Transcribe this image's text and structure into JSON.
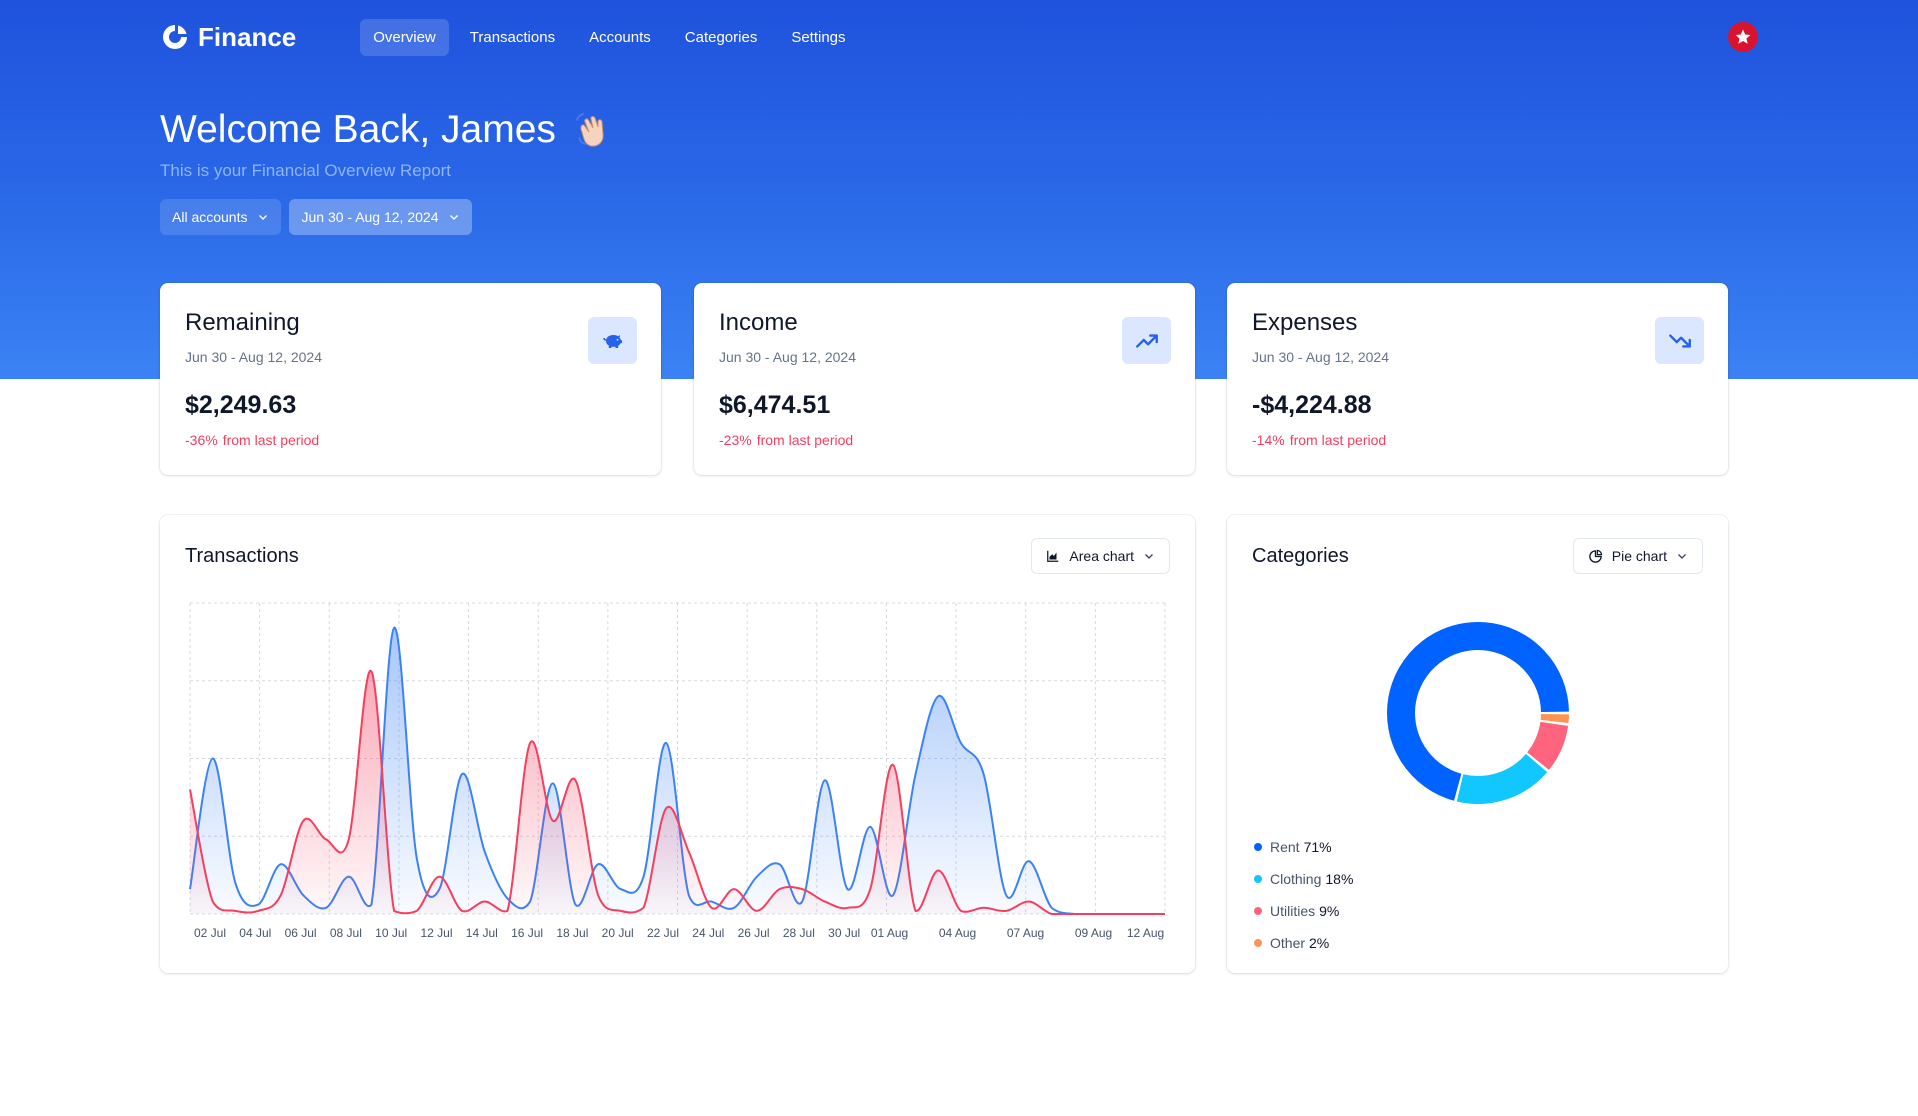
{
  "header": {
    "brand": "Finance",
    "nav": [
      {
        "label": "Overview",
        "active": true
      },
      {
        "label": "Transactions",
        "active": false
      },
      {
        "label": "Accounts",
        "active": false
      },
      {
        "label": "Categories",
        "active": false
      },
      {
        "label": "Settings",
        "active": false
      }
    ]
  },
  "welcome": {
    "title": "Welcome Back, James",
    "subtitle": "This is your Financial Overview Report"
  },
  "filters": {
    "account": "All accounts",
    "date_range": "Jun 30 - Aug 12, 2024"
  },
  "stats": [
    {
      "title": "Remaining",
      "range": "Jun 30 - Aug 12, 2024",
      "value": "$2,249.63",
      "change": "-36%",
      "change_label": "from last period",
      "icon": "piggy-bank-icon"
    },
    {
      "title": "Income",
      "range": "Jun 30 - Aug 12, 2024",
      "value": "$6,474.51",
      "change": "-23%",
      "change_label": "from last period",
      "icon": "trending-up-icon"
    },
    {
      "title": "Expenses",
      "range": "Jun 30 - Aug 12, 2024",
      "value": "-$4,224.88",
      "change": "-14%",
      "change_label": "from last period",
      "icon": "trending-down-icon"
    }
  ],
  "transactions_panel": {
    "title": "Transactions",
    "chart_type_label": "Area chart"
  },
  "categories_panel": {
    "title": "Categories",
    "chart_type_label": "Pie chart"
  },
  "colors": {
    "income": "#3b82f6",
    "expenses": "#f43f5e",
    "rent": "#0062ff",
    "clothing": "#12c6ff",
    "utilities": "#ff647f",
    "other": "#ff9354"
  },
  "chart_data": [
    {
      "type": "area",
      "title": "",
      "x_tick_labels": [
        "02 Jul",
        "04 Jul",
        "06 Jul",
        "08 Jul",
        "10 Jul",
        "12 Jul",
        "14 Jul",
        "16 Jul",
        "18 Jul",
        "20 Jul",
        "22 Jul",
        "24 Jul",
        "26 Jul",
        "28 Jul",
        "30 Jul",
        "01 Aug",
        "04 Aug",
        "07 Aug",
        "09 Aug",
        "12 Aug"
      ],
      "grid": true,
      "ylim": [
        0,
        100
      ],
      "series": [
        {
          "color": "#3b82f6",
          "points": [
            {
              "x": "2024-06-30",
              "y": 8
            },
            {
              "x": "2024-07-01",
              "y": 50
            },
            {
              "x": "2024-07-02",
              "y": 10
            },
            {
              "x": "2024-07-03",
              "y": 3
            },
            {
              "x": "2024-07-04",
              "y": 16
            },
            {
              "x": "2024-07-05",
              "y": 6
            },
            {
              "x": "2024-07-06",
              "y": 2
            },
            {
              "x": "2024-07-07",
              "y": 12
            },
            {
              "x": "2024-07-08",
              "y": 3
            },
            {
              "x": "2024-07-09",
              "y": 92
            },
            {
              "x": "2024-07-10",
              "y": 18
            },
            {
              "x": "2024-07-11",
              "y": 8
            },
            {
              "x": "2024-07-12",
              "y": 45
            },
            {
              "x": "2024-07-13",
              "y": 20
            },
            {
              "x": "2024-07-14",
              "y": 5
            },
            {
              "x": "2024-07-15",
              "y": 4
            },
            {
              "x": "2024-07-16",
              "y": 42
            },
            {
              "x": "2024-07-17",
              "y": 3
            },
            {
              "x": "2024-07-18",
              "y": 16
            },
            {
              "x": "2024-07-19",
              "y": 8
            },
            {
              "x": "2024-07-20",
              "y": 12
            },
            {
              "x": "2024-07-21",
              "y": 55
            },
            {
              "x": "2024-07-22",
              "y": 6
            },
            {
              "x": "2024-07-23",
              "y": 4
            },
            {
              "x": "2024-07-24",
              "y": 2
            },
            {
              "x": "2024-07-25",
              "y": 12
            },
            {
              "x": "2024-07-26",
              "y": 16
            },
            {
              "x": "2024-07-27",
              "y": 4
            },
            {
              "x": "2024-07-28",
              "y": 43
            },
            {
              "x": "2024-07-29",
              "y": 8
            },
            {
              "x": "2024-07-30",
              "y": 28
            },
            {
              "x": "2024-07-31",
              "y": 6
            },
            {
              "x": "2024-08-01",
              "y": 45
            },
            {
              "x": "2024-08-02",
              "y": 70
            },
            {
              "x": "2024-08-03",
              "y": 55
            },
            {
              "x": "2024-08-04",
              "y": 45
            },
            {
              "x": "2024-08-05",
              "y": 6
            },
            {
              "x": "2024-08-06",
              "y": 17
            },
            {
              "x": "2024-08-07",
              "y": 2
            },
            {
              "x": "2024-08-08",
              "y": 0
            },
            {
              "x": "2024-08-09",
              "y": 0
            },
            {
              "x": "2024-08-10",
              "y": 0
            },
            {
              "x": "2024-08-11",
              "y": 0
            },
            {
              "x": "2024-08-12",
              "y": 0
            }
          ]
        },
        {
          "color": "#f43f5e",
          "points": [
            {
              "x": "2024-06-30",
              "y": 40
            },
            {
              "x": "2024-07-01",
              "y": 4
            },
            {
              "x": "2024-07-02",
              "y": 1
            },
            {
              "x": "2024-07-03",
              "y": 1
            },
            {
              "x": "2024-07-04",
              "y": 6
            },
            {
              "x": "2024-07-05",
              "y": 30
            },
            {
              "x": "2024-07-06",
              "y": 24
            },
            {
              "x": "2024-07-07",
              "y": 24
            },
            {
              "x": "2024-07-08",
              "y": 78
            },
            {
              "x": "2024-07-09",
              "y": 1
            },
            {
              "x": "2024-07-10",
              "y": 1
            },
            {
              "x": "2024-07-11",
              "y": 12
            },
            {
              "x": "2024-07-12",
              "y": 1
            },
            {
              "x": "2024-07-13",
              "y": 4
            },
            {
              "x": "2024-07-14",
              "y": 1
            },
            {
              "x": "2024-07-15",
              "y": 55
            },
            {
              "x": "2024-07-16",
              "y": 30
            },
            {
              "x": "2024-07-17",
              "y": 43
            },
            {
              "x": "2024-07-18",
              "y": 6
            },
            {
              "x": "2024-07-19",
              "y": 1
            },
            {
              "x": "2024-07-20",
              "y": 2
            },
            {
              "x": "2024-07-21",
              "y": 34
            },
            {
              "x": "2024-07-22",
              "y": 20
            },
            {
              "x": "2024-07-23",
              "y": 2
            },
            {
              "x": "2024-07-24",
              "y": 8
            },
            {
              "x": "2024-07-25",
              "y": 1
            },
            {
              "x": "2024-07-26",
              "y": 8
            },
            {
              "x": "2024-07-27",
              "y": 8
            },
            {
              "x": "2024-07-28",
              "y": 4
            },
            {
              "x": "2024-07-29",
              "y": 2
            },
            {
              "x": "2024-07-30",
              "y": 8
            },
            {
              "x": "2024-07-31",
              "y": 48
            },
            {
              "x": "2024-08-01",
              "y": 1
            },
            {
              "x": "2024-08-02",
              "y": 14
            },
            {
              "x": "2024-08-03",
              "y": 1
            },
            {
              "x": "2024-08-04",
              "y": 2
            },
            {
              "x": "2024-08-05",
              "y": 1
            },
            {
              "x": "2024-08-06",
              "y": 4
            },
            {
              "x": "2024-08-07",
              "y": 0
            },
            {
              "x": "2024-08-08",
              "y": 0
            },
            {
              "x": "2024-08-09",
              "y": 0
            },
            {
              "x": "2024-08-10",
              "y": 0
            },
            {
              "x": "2024-08-11",
              "y": 0
            },
            {
              "x": "2024-08-12",
              "y": 0
            }
          ]
        }
      ]
    },
    {
      "type": "pie",
      "title": "",
      "donut": true,
      "legend_position": "bottom-left",
      "slices": [
        {
          "label": "Rent",
          "pct_label": "71%",
          "value": 71,
          "color": "#0062ff"
        },
        {
          "label": "Clothing",
          "pct_label": "18%",
          "value": 18,
          "color": "#12c6ff"
        },
        {
          "label": "Utilities",
          "pct_label": "9%",
          "value": 9,
          "color": "#ff647f"
        },
        {
          "label": "Other",
          "pct_label": "2%",
          "value": 2,
          "color": "#ff9354"
        }
      ]
    }
  ]
}
